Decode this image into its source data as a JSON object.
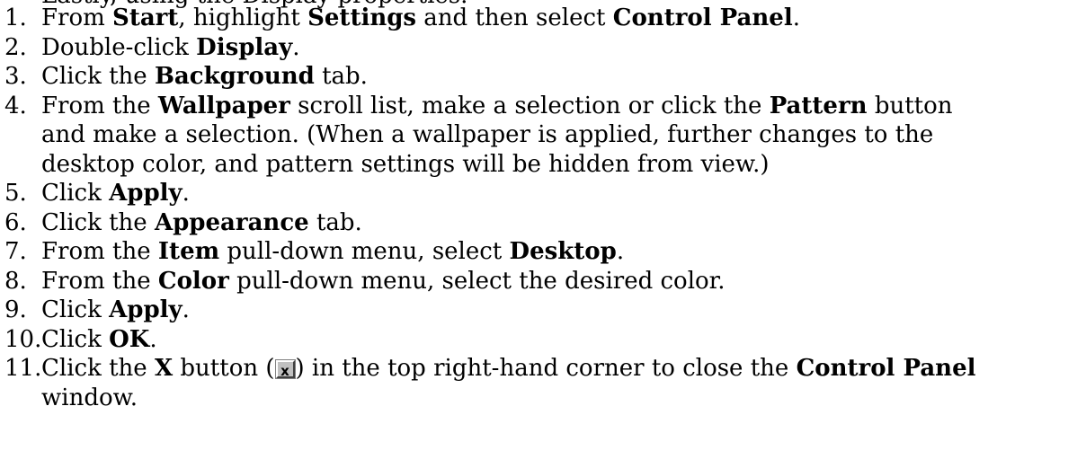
{
  "clipped_top_line": "Lastly, using the Display properties.",
  "steps": [
    {
      "num": "1.",
      "parts": [
        "From ",
        "Start",
        ", highlight ",
        "Settings",
        " and then select ",
        "Control Panel",
        "."
      ]
    },
    {
      "num": "2.",
      "parts": [
        "Double-click ",
        "Display",
        "."
      ]
    },
    {
      "num": "3.",
      "parts": [
        "Click the ",
        "Background",
        " tab."
      ]
    },
    {
      "num": "4.",
      "line1": [
        "From the ",
        "Wallpaper",
        " scroll list, make a selection or click the ",
        "Pattern",
        " button"
      ],
      "line2": "and make a selection. (When a wallpaper is applied, further changes to the",
      "line3": "desktop color, and pattern settings will be hidden from view.)"
    },
    {
      "num": "5.",
      "parts": [
        "Click ",
        "Apply",
        "."
      ]
    },
    {
      "num": "6.",
      "parts": [
        "Click the ",
        "Appearance",
        " tab."
      ]
    },
    {
      "num": "7.",
      "parts": [
        "From the ",
        "Item",
        " pull-down menu, select ",
        "Desktop",
        "."
      ]
    },
    {
      "num": "8.",
      "parts": [
        "From the ",
        "Color",
        " pull-down menu, select the desired color."
      ]
    },
    {
      "num": "9.",
      "parts": [
        "Click ",
        "Apply",
        "."
      ]
    },
    {
      "num": "10.",
      "parts": [
        "Click ",
        "OK",
        "."
      ]
    },
    {
      "num": "11.",
      "line1": [
        "Click the ",
        "X",
        " button (",
        ") in the top right-hand corner to close the ",
        "Control Panel"
      ],
      "line2": "window.",
      "icon": "close-x-button-icon"
    }
  ]
}
